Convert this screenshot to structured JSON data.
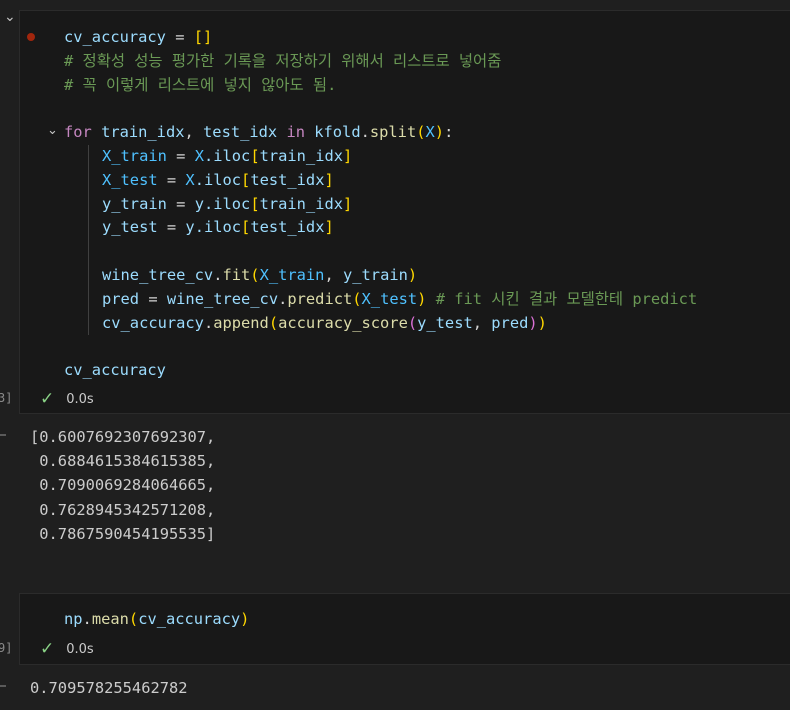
{
  "cell1": {
    "exec_count": "3]",
    "status_time": "0.0s",
    "output": [
      "[0.6007692307692307,",
      " 0.6884615384615385,",
      " 0.7090069284064665,",
      " 0.7628945342571208,",
      " 0.7867590454195535]"
    ],
    "code": {
      "l1_var": "cv_accuracy",
      "l1_eq": " = ",
      "l1_br": "[]",
      "l2_comment": "# 정확성 성능 평가한 기록을 저장하기 위해서 리스트로 넣어줌",
      "l3_comment": "# 꼭 이렇게 리스트에 넣지 않아도 됨.",
      "l5_for": "for",
      "l5_a": " train_idx",
      "l5_comma": ", ",
      "l5_b": "test_idx",
      "l5_in": " in ",
      "l5_kfold": "kfold",
      "l5_dot": ".",
      "l5_split": "split",
      "l5_p1": "(",
      "l5_X": "X",
      "l5_p2": ")",
      "l5_colon": ":",
      "l6_lhs": "X_train",
      "l6_eq": " = ",
      "l6_X": "X",
      "l6_iloc": ".iloc",
      "l6_b1": "[",
      "l6_idx": "train_idx",
      "l6_b2": "]",
      "l7_lhs": "X_test",
      "l7_eq": " = ",
      "l7_X": "X",
      "l7_iloc": ".iloc",
      "l7_b1": "[",
      "l7_idx": "test_idx",
      "l7_b2": "]",
      "l8_lhs": "y_train",
      "l8_eq": " = ",
      "l8_y": "y",
      "l8_iloc": ".iloc",
      "l8_b1": "[",
      "l8_idx": "train_idx",
      "l8_b2": "]",
      "l9_lhs": "y_test",
      "l9_eq": " = ",
      "l9_y": "y",
      "l9_iloc": ".iloc",
      "l9_b1": "[",
      "l9_idx": "test_idx",
      "l9_b2": "]",
      "l11_obj": "wine_tree_cv",
      "l11_dot": ".",
      "l11_fit": "fit",
      "l11_p1": "(",
      "l11_a": "X_train",
      "l11_comma": ", ",
      "l11_b": "y_train",
      "l11_p2": ")",
      "l12_lhs": "pred",
      "l12_eq": " = ",
      "l12_obj": "wine_tree_cv",
      "l12_dot": ".",
      "l12_fn": "predict",
      "l12_p1": "(",
      "l12_arg": "X_test",
      "l12_p2": ")",
      "l12_comment": " # fit 시킨 결과 모델한테 predict",
      "l13_obj": "cv_accuracy",
      "l13_dot": ".",
      "l13_fn": "append",
      "l13_p1": "(",
      "l13_fn2": "accuracy_score",
      "l13_p2": "(",
      "l13_a": "y_test",
      "l13_comma": ", ",
      "l13_b": "pred",
      "l13_p3": ")",
      "l13_p4": ")",
      "l15_var": "cv_accuracy"
    }
  },
  "cell2": {
    "exec_count": "9]",
    "status_time": "0.0s",
    "code": {
      "np": "np",
      "dot": ".",
      "mean": "mean",
      "p1": "(",
      "arg": "cv_accuracy",
      "p2": ")"
    },
    "output": "0.709578255462782"
  },
  "colors": {
    "background": "#1f1f1f",
    "cell_background": "#181818",
    "keyword": "#c586c0",
    "function": "#dcdcaa",
    "variable": "#9cdcfe",
    "class": "#4fc1ff",
    "comment": "#6a9955",
    "check": "#89d185",
    "breakpoint": "#a1260d"
  },
  "icons": {
    "collapse": "chevron-down-icon",
    "fold": "fold-chevron-icon",
    "success": "check-icon",
    "breakpoint": "breakpoint-dot-icon"
  }
}
